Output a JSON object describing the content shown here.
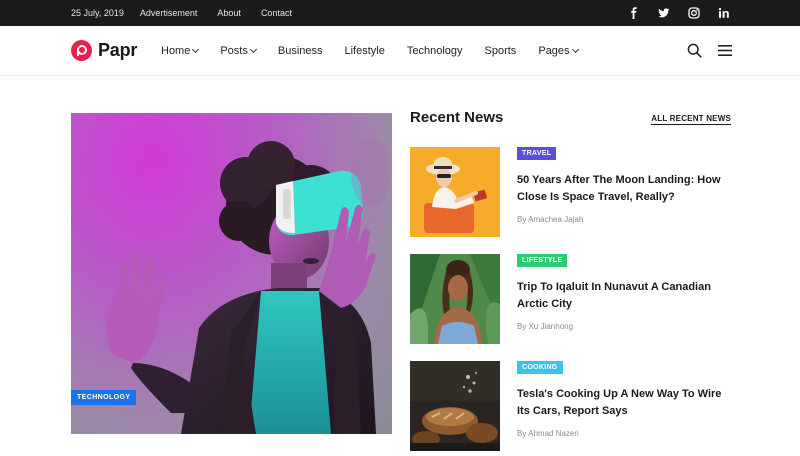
{
  "topbar": {
    "date": "25 July, 2019",
    "links": [
      "Advertisement",
      "About",
      "Contact"
    ],
    "social_icons": [
      "facebook-icon",
      "twitter-icon",
      "instagram-icon",
      "linkedin-icon"
    ]
  },
  "header": {
    "logo": "Papr",
    "nav": [
      {
        "label": "Home",
        "dropdown": true
      },
      {
        "label": "Posts",
        "dropdown": true
      },
      {
        "label": "Business",
        "dropdown": false
      },
      {
        "label": "Lifestyle",
        "dropdown": false
      },
      {
        "label": "Technology",
        "dropdown": false
      },
      {
        "label": "Sports",
        "dropdown": false
      },
      {
        "label": "Pages",
        "dropdown": true
      }
    ],
    "icons": [
      "search-icon",
      "menu-icon"
    ]
  },
  "featured": {
    "tag": "TECHNOLOGY",
    "tag_color": "#1a73e8"
  },
  "recent": {
    "title": "Recent News",
    "all_link": "ALL RECENT NEWS",
    "items": [
      {
        "category": "TRAVEL",
        "category_color": "#5b4ed8",
        "headline": "50 Years After The Moon Landing: How Close Is Space Travel, Really?",
        "author": "By Amachea Jajah"
      },
      {
        "category": "LIFESTYLE",
        "category_color": "#2ecc71",
        "headline": "Trip To Iqaluit In Nunavut A Canadian Arctic City",
        "author": "By Xu Jianhong"
      },
      {
        "category": "COOKING",
        "category_color": "#3fc1e8",
        "headline": "Tesla's Cooking Up A New Way To Wire Its Cars, Report Says",
        "author": "By Ahmad Nazeri"
      }
    ]
  },
  "colors": {
    "brand": "#ee1d4a",
    "topbar_bg": "#1b1b1b"
  }
}
